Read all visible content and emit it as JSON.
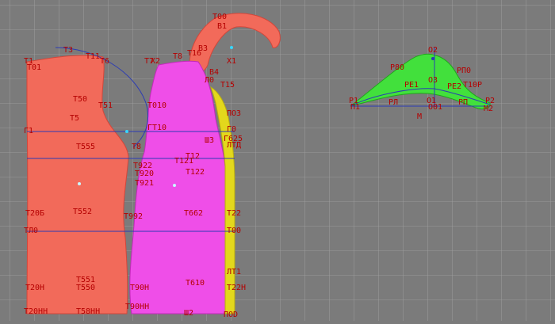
{
  "colors": {
    "background": "#7b7b7b",
    "grid": "#a4a4a4",
    "back_piece": "#f26a5a",
    "front_piece": "#ef4ee8",
    "facing_strip": "#e3d81c",
    "sleeve": "#42e03c",
    "collar": "#f26a5a",
    "construction_line": "#2b3bb4",
    "label": "#b40000"
  },
  "labels": {
    "too": "Т00",
    "b1": "В1",
    "t3": "Т3",
    "t11": "Т11",
    "t6": "Т6",
    "t1": "Т1",
    "t01": "Т01",
    "t7": "Т7",
    "x2": "Х2",
    "t8": "Т8",
    "b3": "В3",
    "t16": "Т16",
    "x1": "Х1",
    "b4": "В4",
    "l0": "Л0",
    "t15": "Т15",
    "t50": "Т50",
    "t51": "Т51",
    "t5": "Т5",
    "t010": "Т010",
    "po3": "ПО3",
    "g1": "Г1",
    "gt10": "ГТ10",
    "g0": "Г0",
    "sh3": "Ш3",
    "pf25": "Г625",
    "ltd": "ЛТД",
    "t555": "Т555",
    "t8b": "Т8",
    "t12": "Т12",
    "t121": "Т121",
    "t922": "Т922",
    "t920": "Т920",
    "t122": "Т122",
    "t921": "Т921",
    "t20b": "Т20Б",
    "t552": "Т552",
    "t992": "Т992",
    "t662": "Т662",
    "t22": "Т22",
    "tl0": "ТЛ0",
    "t00": "Т00",
    "t551": "Т551",
    "t20n": "Т20Н",
    "t550": "Т550",
    "t90n": "Т90Н",
    "t610": "Т610",
    "lt1": "ЛТ1",
    "t22n": "Т22Н",
    "t20nn": "Т20НН",
    "t58nn": "Т58НН",
    "t90nn": "Т90НН",
    "sh2": "Ш2",
    "pod": "ПОD",
    "o2": "О2",
    "r80": "Р80",
    "rp0": "РП0",
    "o3": "О3",
    "re1": "РЕ1",
    "re2": "РЕ2",
    "t10r": "Т10Р",
    "r1": "Р1",
    "rl": "РЛ",
    "o1": "О1",
    "rp": "РП",
    "r2": "Р2",
    "p1": "П1",
    "o01": "О01",
    "m2": "М2",
    "m": "М"
  }
}
